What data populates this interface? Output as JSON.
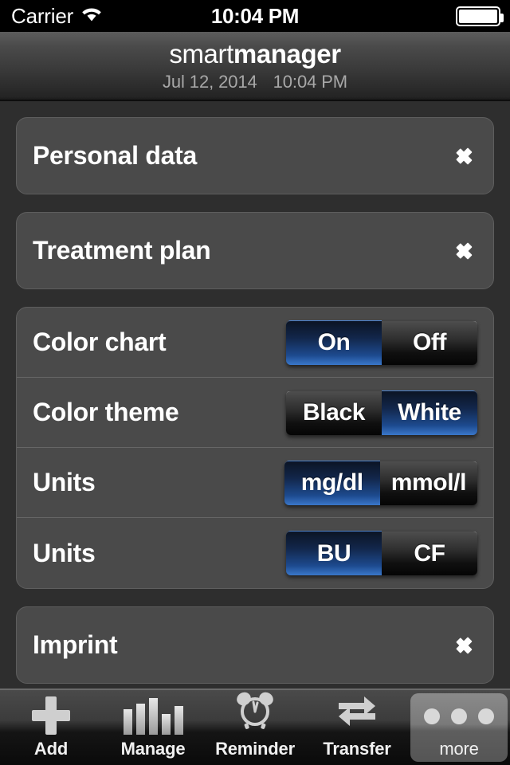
{
  "status_bar": {
    "carrier": "Carrier",
    "wifi_icon": "wifi-icon",
    "time": "10:04 PM",
    "battery_icon": "battery-full-icon"
  },
  "header": {
    "title_light": "smart",
    "title_bold": "manager",
    "date": "Jul 12, 2014",
    "time": "10:04 PM"
  },
  "nav_rows": [
    {
      "label": "Personal data",
      "chevron": "chevron-right-icon"
    },
    {
      "label": "Treatment plan",
      "chevron": "chevron-right-icon"
    }
  ],
  "settings": [
    {
      "label": "Color chart",
      "name": "color-chart",
      "options": [
        {
          "text": "On",
          "selected": true
        },
        {
          "text": "Off",
          "selected": false
        }
      ]
    },
    {
      "label": "Color theme",
      "name": "color-theme",
      "options": [
        {
          "text": "Black",
          "selected": false
        },
        {
          "text": "White",
          "selected": true
        }
      ]
    },
    {
      "label": "Units",
      "name": "units-glucose",
      "options": [
        {
          "text": "mg/dl",
          "selected": true
        },
        {
          "text": "mmol/l",
          "selected": false
        }
      ]
    },
    {
      "label": "Units",
      "name": "units-carbs",
      "options": [
        {
          "text": "BU",
          "selected": true
        },
        {
          "text": "CF",
          "selected": false
        }
      ]
    }
  ],
  "imprint_row": {
    "label": "Imprint",
    "chevron": "chevron-right-icon"
  },
  "toolbar": {
    "tabs": [
      {
        "label": "Add",
        "icon": "plus-icon",
        "selected": false
      },
      {
        "label": "Manage",
        "icon": "bar-chart-icon",
        "selected": false
      },
      {
        "label": "Reminder",
        "icon": "alarm-clock-icon",
        "selected": false
      },
      {
        "label": "Transfer",
        "icon": "transfer-arrows-icon",
        "selected": false
      },
      {
        "label": "more",
        "icon": "ellipsis-icon",
        "selected": true
      }
    ]
  },
  "colors": {
    "background": "#2e2e2e",
    "card": "#4a4a4a",
    "accent_blue": "#1d4a8e",
    "text": "#ffffff",
    "subtext": "#a8a8a8"
  }
}
